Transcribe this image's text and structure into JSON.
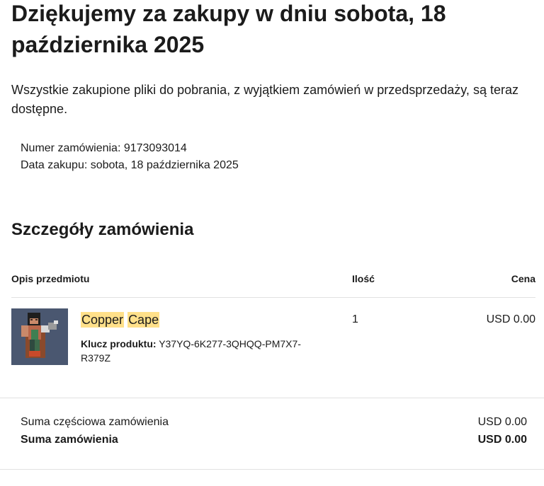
{
  "header": {
    "title": "Dziękujemy za zakupy w dniu sobota, 18 października 2025",
    "intro": "Wszystkie zakupione pliki do pobrania, z wyjątkiem zamówień w przedsprzedaży, są teraz dostępne."
  },
  "order_meta": {
    "order_number": "Numer zamówienia: 9173093014",
    "purchase_date": "Data zakupu: sobota, 18 października 2025"
  },
  "details": {
    "section_title": "Szczegóły zamówienia",
    "columns": {
      "description": "Opis przedmiotu",
      "quantity": "Ilość",
      "price": "Cena"
    },
    "items": [
      {
        "name_part1": "Copper",
        "name_part2": "Cape",
        "key_label": "Klucz produktu:",
        "key_value": "Y37YQ-6K277-3QHQQ-PM7X7-R379Z",
        "quantity": "1",
        "price": "USD 0.00",
        "image_icon": "minecraft-character-copper-cape"
      }
    ]
  },
  "totals": {
    "subtotal_label": "Suma częściowa zamówienia",
    "subtotal_value": "USD 0.00",
    "total_label": "Suma zamówienia",
    "total_value": "USD 0.00"
  },
  "colors": {
    "text": "#1b1b1b",
    "highlight": "#ffe08a",
    "divider": "#e1e1e1",
    "thumbnail_bg": "#4a5770"
  }
}
